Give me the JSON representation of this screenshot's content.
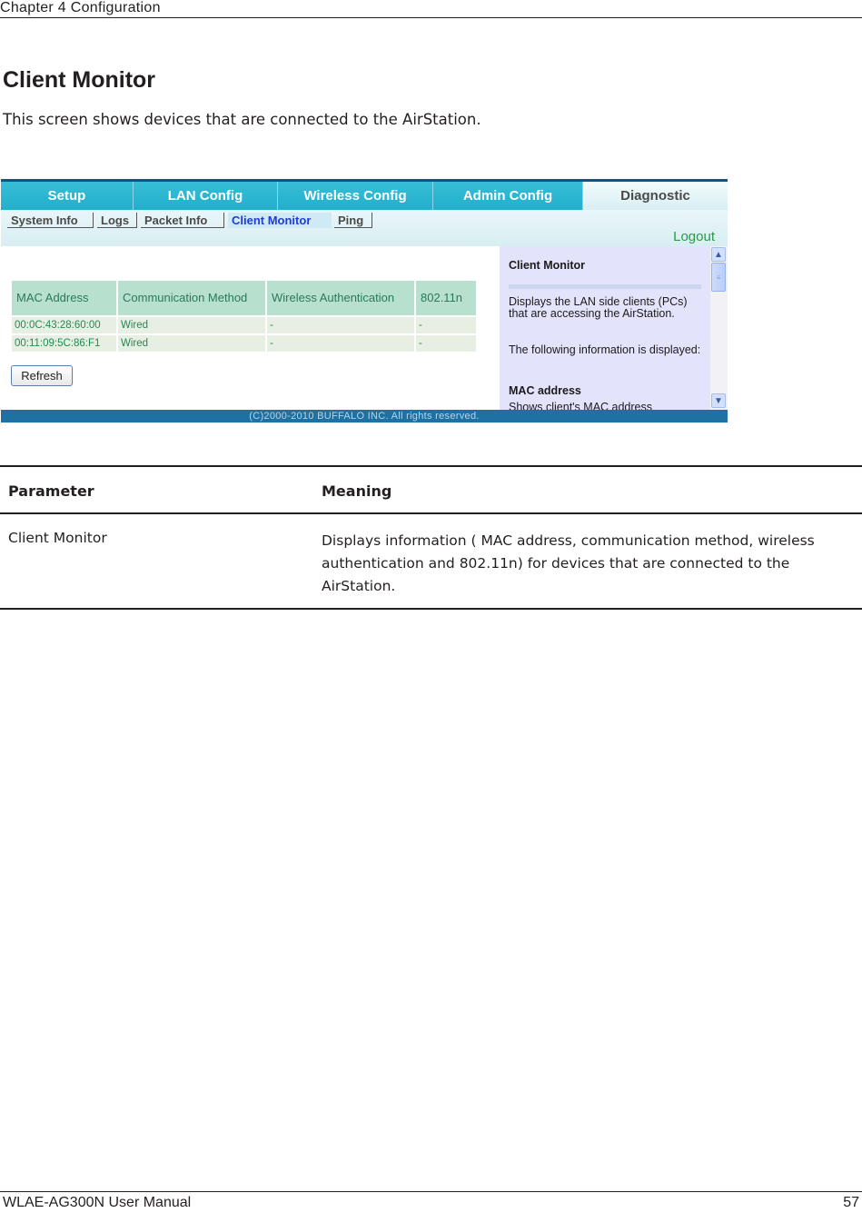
{
  "header": {
    "chapter": "Chapter 4  Configuration"
  },
  "section": {
    "title": "Client Monitor",
    "intro": "This screen shows devices that are connected to the AirStation."
  },
  "screenshot": {
    "main_tabs": [
      {
        "label": "Setup",
        "active": false
      },
      {
        "label": "LAN Config",
        "active": false
      },
      {
        "label": "Wireless Config",
        "active": false
      },
      {
        "label": "Admin Config",
        "active": false
      },
      {
        "label": "Diagnostic",
        "active": true
      }
    ],
    "sub_tabs": [
      {
        "label": "System Info",
        "active": false
      },
      {
        "label": "Logs",
        "active": false
      },
      {
        "label": "Packet Info",
        "active": false
      },
      {
        "label": "Client Monitor",
        "active": true
      },
      {
        "label": "Ping",
        "active": false
      }
    ],
    "logout": "Logout",
    "table": {
      "headers": [
        "MAC Address",
        "Communication Method",
        "Wireless Authentication",
        "802.11n"
      ],
      "rows": [
        [
          "00:0C:43:28:60:00",
          "Wired",
          "-",
          "-"
        ],
        [
          "00:11:09:5C:86:F1",
          "Wired",
          "-",
          "-"
        ]
      ]
    },
    "refresh_button": "Refresh",
    "help": {
      "title": "Client Monitor",
      "para1": "Displays the LAN side clients (PCs) that are accessing the AirStation.",
      "para2": "The following information is displayed:",
      "subheading": "MAC address",
      "para3": "Shows client's MAC address"
    },
    "footer": "(C)2000-2010 BUFFALO INC. All rights reserved."
  },
  "param_table": {
    "headers": [
      "Parameter",
      "Meaning"
    ],
    "rows": [
      [
        "Client Monitor",
        "Displays information ( MAC address, communication method, wireless authentication and 802.11n) for devices that are connected to the AirStation."
      ]
    ]
  },
  "footer": {
    "manual": "WLAE-AG300N User Manual",
    "page": "57"
  }
}
